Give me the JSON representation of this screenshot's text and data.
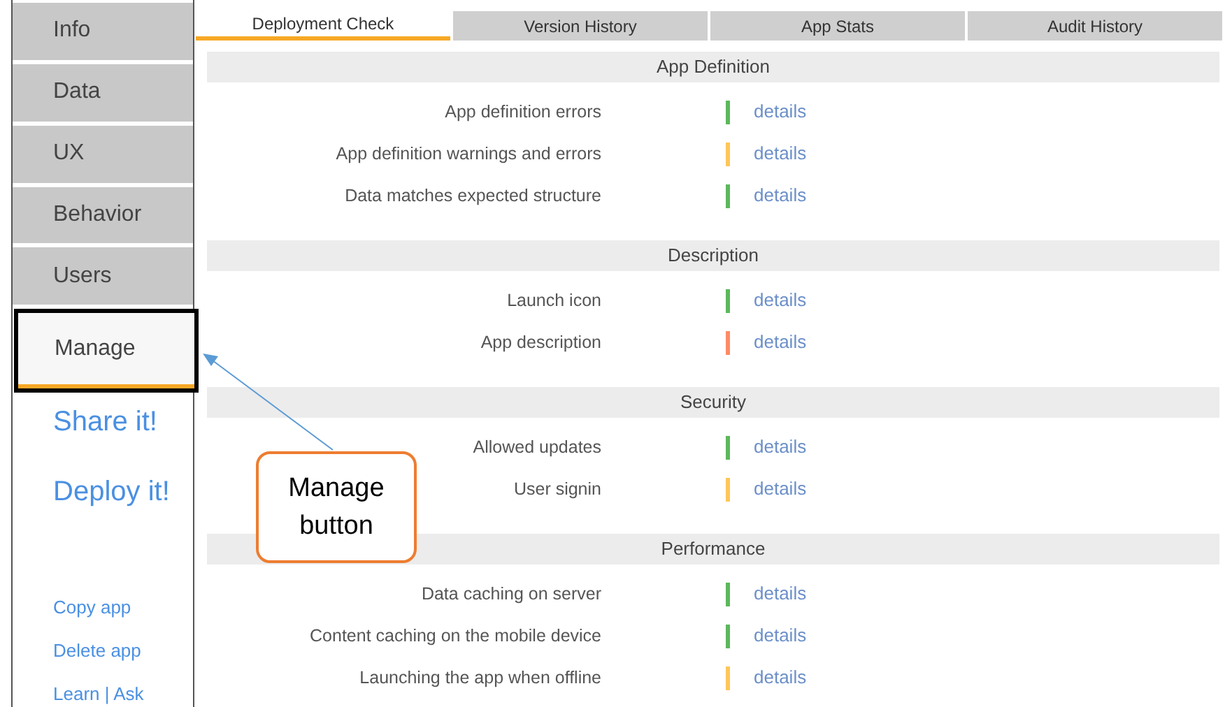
{
  "sidebar": {
    "items": [
      {
        "label": "Info",
        "selected": false,
        "highlighted": false
      },
      {
        "label": "Data",
        "selected": false,
        "highlighted": false
      },
      {
        "label": "UX",
        "selected": false,
        "highlighted": false
      },
      {
        "label": "Behavior",
        "selected": false,
        "highlighted": false
      },
      {
        "label": "Users",
        "selected": false,
        "highlighted": false
      },
      {
        "label": "Manage",
        "selected": true,
        "highlighted": true
      }
    ],
    "actions": [
      "Share it!",
      "Deploy it!"
    ],
    "links": [
      "Copy app",
      "Delete app",
      "Learn | Ask"
    ]
  },
  "tabs": [
    {
      "label": "Deployment Check",
      "selected": true
    },
    {
      "label": "Version History",
      "selected": false
    },
    {
      "label": "App Stats",
      "selected": false
    },
    {
      "label": "Audit History",
      "selected": false
    }
  ],
  "sections": [
    {
      "title": "App Definition",
      "checks": [
        {
          "label": "App definition errors",
          "color": "#5cb85c",
          "link": "details"
        },
        {
          "label": "App definition warnings and errors",
          "color": "#ffc65a",
          "link": "details"
        },
        {
          "label": "Data matches expected structure",
          "color": "#5cb85c",
          "link": "details"
        }
      ]
    },
    {
      "title": "Description",
      "checks": [
        {
          "label": "Launch icon",
          "color": "#5cb85c",
          "link": "details"
        },
        {
          "label": "App description",
          "color": "#ff8a65",
          "link": "details"
        }
      ]
    },
    {
      "title": "Security",
      "checks": [
        {
          "label": "Allowed updates",
          "color": "#5cb85c",
          "link": "details"
        },
        {
          "label": "User signin",
          "color": "#ffc65a",
          "link": "details"
        }
      ]
    },
    {
      "title": "Performance",
      "checks": [
        {
          "label": "Data caching on server",
          "color": "#5cb85c",
          "link": "details"
        },
        {
          "label": "Content caching on the mobile device",
          "color": "#5cb85c",
          "link": "details"
        },
        {
          "label": "Launching the app when offline",
          "color": "#ffc65a",
          "link": "details"
        }
      ]
    }
  ],
  "callout": {
    "text": "Manage button"
  }
}
